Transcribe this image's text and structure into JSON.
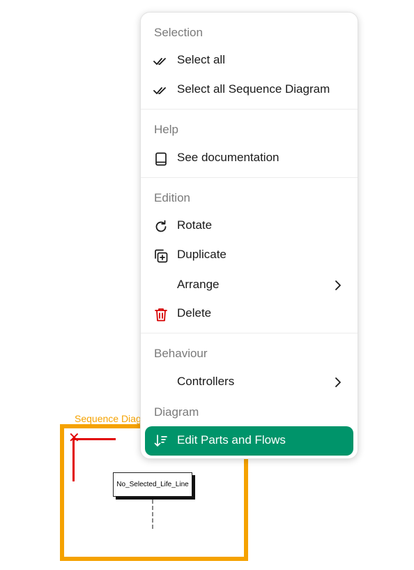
{
  "diagram": {
    "frame_label": "Sequence Diag",
    "lifeline_label": "No_Selected_Life_Line",
    "accent_color": "#f5a200",
    "axis_color": "#e10000"
  },
  "menu": {
    "sections": {
      "selection": "Selection",
      "help": "Help",
      "edition": "Edition",
      "behaviour": "Behaviour",
      "diagram": "Diagram"
    },
    "items": {
      "select_all": {
        "label": "Select all",
        "icon": "double-check-icon"
      },
      "select_all_sequence": {
        "label": "Select all Sequence Diagram",
        "icon": "double-check-icon"
      },
      "see_documentation": {
        "label": "See documentation",
        "icon": "book-icon"
      },
      "rotate": {
        "label": "Rotate",
        "icon": "rotate-icon"
      },
      "duplicate": {
        "label": "Duplicate",
        "icon": "duplicate-icon"
      },
      "arrange": {
        "label": "Arrange",
        "icon": "chevron-right-icon"
      },
      "delete": {
        "label": "Delete",
        "icon": "trash-icon",
        "color": "#d60000"
      },
      "controllers": {
        "label": "Controllers",
        "icon": "chevron-right-icon"
      },
      "edit_parts_flows": {
        "label": "Edit Parts and Flows",
        "icon": "sort-down-icon",
        "highlight": "#00946a"
      }
    }
  }
}
